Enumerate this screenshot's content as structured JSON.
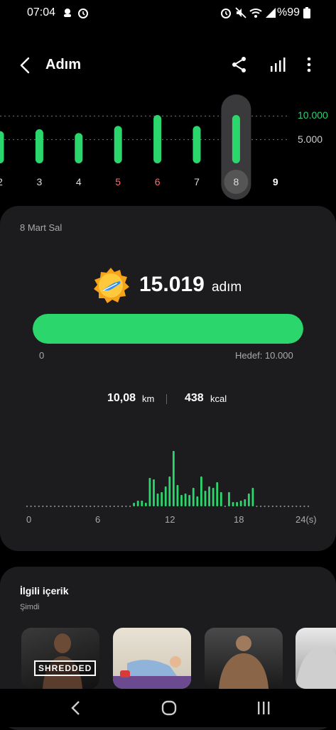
{
  "status": {
    "time": "07:04",
    "battery": "%99"
  },
  "header": {
    "title": "Adım"
  },
  "week": {
    "days": [
      {
        "label": "2",
        "steps": 6800,
        "style": "normal"
      },
      {
        "label": "3",
        "steps": 7200,
        "style": "normal"
      },
      {
        "label": "4",
        "steps": 6400,
        "style": "normal"
      },
      {
        "label": "5",
        "steps": 7900,
        "style": "red"
      },
      {
        "label": "6",
        "steps": 10200,
        "style": "red"
      },
      {
        "label": "7",
        "steps": 7900,
        "style": "normal"
      },
      {
        "label": "8",
        "steps": 10200,
        "style": "selected"
      },
      {
        "label": "9",
        "steps": 0,
        "style": "bold"
      }
    ],
    "goal_lines": [
      {
        "label": "10.000",
        "value": 10000,
        "color": "#2bd66c"
      },
      {
        "label": "5.000",
        "value": 5000,
        "color": "#cccccc"
      }
    ]
  },
  "summary": {
    "date": "8 Mart Sal",
    "steps": "15.019",
    "steps_unit": "adım",
    "progress_fraction": 1.0,
    "progress_min": "0",
    "goal": "Hedef: 10.000",
    "distance": "10,08",
    "distance_unit": "km",
    "calories": "438",
    "calories_unit": "kcal"
  },
  "hourly": {
    "ticks": [
      "0",
      "6",
      "12",
      "18",
      "24(s)"
    ],
    "values": [
      0,
      0,
      0,
      0,
      0,
      0,
      0,
      0,
      0,
      0,
      0,
      0,
      0,
      0,
      0,
      0,
      0,
      0,
      0,
      0,
      0,
      0,
      0,
      0,
      0,
      0,
      0,
      5,
      8,
      8,
      5,
      40,
      38,
      18,
      20,
      28,
      42,
      78,
      30,
      16,
      18,
      16,
      26,
      14,
      42,
      22,
      28,
      26,
      34,
      20,
      0,
      20,
      6,
      6,
      8,
      10,
      18,
      26,
      0,
      0,
      0,
      0,
      0,
      0,
      0,
      0,
      0,
      0,
      0,
      0,
      0,
      0
    ]
  },
  "related": {
    "title": "İlgili içerik",
    "subtitle": "Şimdi",
    "items": [
      {
        "label": "SHREDDED"
      },
      {
        "label": ""
      },
      {
        "label": ""
      },
      {
        "label": ""
      }
    ]
  },
  "colors": {
    "accent": "#2bd66c",
    "card": "#1c1c1e",
    "red": "#ff6b6b"
  }
}
